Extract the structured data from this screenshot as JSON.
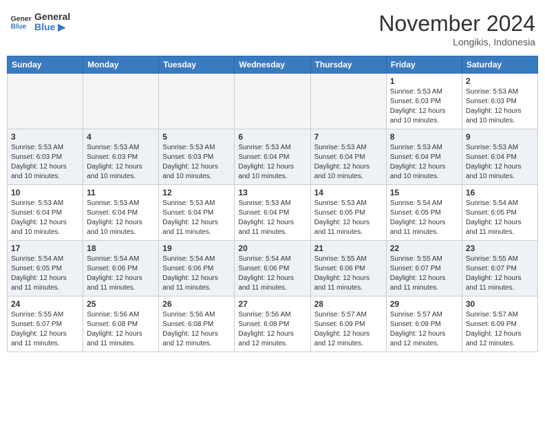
{
  "header": {
    "logo_line1": "General",
    "logo_line2": "Blue",
    "month_title": "November 2024",
    "location": "Longikis, Indonesia"
  },
  "weekdays": [
    "Sunday",
    "Monday",
    "Tuesday",
    "Wednesday",
    "Thursday",
    "Friday",
    "Saturday"
  ],
  "weeks": [
    [
      {
        "day": "",
        "empty": true
      },
      {
        "day": "",
        "empty": true
      },
      {
        "day": "",
        "empty": true
      },
      {
        "day": "",
        "empty": true
      },
      {
        "day": "",
        "empty": true
      },
      {
        "day": "1",
        "sunrise": "5:53 AM",
        "sunset": "6:03 PM",
        "daylight": "12 hours and 10 minutes."
      },
      {
        "day": "2",
        "sunrise": "5:53 AM",
        "sunset": "6:03 PM",
        "daylight": "12 hours and 10 minutes."
      }
    ],
    [
      {
        "day": "3",
        "sunrise": "5:53 AM",
        "sunset": "6:03 PM",
        "daylight": "12 hours and 10 minutes."
      },
      {
        "day": "4",
        "sunrise": "5:53 AM",
        "sunset": "6:03 PM",
        "daylight": "12 hours and 10 minutes."
      },
      {
        "day": "5",
        "sunrise": "5:53 AM",
        "sunset": "6:03 PM",
        "daylight": "12 hours and 10 minutes."
      },
      {
        "day": "6",
        "sunrise": "5:53 AM",
        "sunset": "6:04 PM",
        "daylight": "12 hours and 10 minutes."
      },
      {
        "day": "7",
        "sunrise": "5:53 AM",
        "sunset": "6:04 PM",
        "daylight": "12 hours and 10 minutes."
      },
      {
        "day": "8",
        "sunrise": "5:53 AM",
        "sunset": "6:04 PM",
        "daylight": "12 hours and 10 minutes."
      },
      {
        "day": "9",
        "sunrise": "5:53 AM",
        "sunset": "6:04 PM",
        "daylight": "12 hours and 10 minutes."
      }
    ],
    [
      {
        "day": "10",
        "sunrise": "5:53 AM",
        "sunset": "6:04 PM",
        "daylight": "12 hours and 10 minutes."
      },
      {
        "day": "11",
        "sunrise": "5:53 AM",
        "sunset": "6:04 PM",
        "daylight": "12 hours and 10 minutes."
      },
      {
        "day": "12",
        "sunrise": "5:53 AM",
        "sunset": "6:04 PM",
        "daylight": "12 hours and 11 minutes."
      },
      {
        "day": "13",
        "sunrise": "5:53 AM",
        "sunset": "6:04 PM",
        "daylight": "12 hours and 11 minutes."
      },
      {
        "day": "14",
        "sunrise": "5:53 AM",
        "sunset": "6:05 PM",
        "daylight": "12 hours and 11 minutes."
      },
      {
        "day": "15",
        "sunrise": "5:54 AM",
        "sunset": "6:05 PM",
        "daylight": "12 hours and 11 minutes."
      },
      {
        "day": "16",
        "sunrise": "5:54 AM",
        "sunset": "6:05 PM",
        "daylight": "12 hours and 11 minutes."
      }
    ],
    [
      {
        "day": "17",
        "sunrise": "5:54 AM",
        "sunset": "6:05 PM",
        "daylight": "12 hours and 11 minutes."
      },
      {
        "day": "18",
        "sunrise": "5:54 AM",
        "sunset": "6:06 PM",
        "daylight": "12 hours and 11 minutes."
      },
      {
        "day": "19",
        "sunrise": "5:54 AM",
        "sunset": "6:06 PM",
        "daylight": "12 hours and 11 minutes."
      },
      {
        "day": "20",
        "sunrise": "5:54 AM",
        "sunset": "6:06 PM",
        "daylight": "12 hours and 11 minutes."
      },
      {
        "day": "21",
        "sunrise": "5:55 AM",
        "sunset": "6:06 PM",
        "daylight": "12 hours and 11 minutes."
      },
      {
        "day": "22",
        "sunrise": "5:55 AM",
        "sunset": "6:07 PM",
        "daylight": "12 hours and 11 minutes."
      },
      {
        "day": "23",
        "sunrise": "5:55 AM",
        "sunset": "6:07 PM",
        "daylight": "12 hours and 11 minutes."
      }
    ],
    [
      {
        "day": "24",
        "sunrise": "5:55 AM",
        "sunset": "6:07 PM",
        "daylight": "12 hours and 11 minutes."
      },
      {
        "day": "25",
        "sunrise": "5:56 AM",
        "sunset": "6:08 PM",
        "daylight": "12 hours and 11 minutes."
      },
      {
        "day": "26",
        "sunrise": "5:56 AM",
        "sunset": "6:08 PM",
        "daylight": "12 hours and 12 minutes."
      },
      {
        "day": "27",
        "sunrise": "5:56 AM",
        "sunset": "6:08 PM",
        "daylight": "12 hours and 12 minutes."
      },
      {
        "day": "28",
        "sunrise": "5:57 AM",
        "sunset": "6:09 PM",
        "daylight": "12 hours and 12 minutes."
      },
      {
        "day": "29",
        "sunrise": "5:57 AM",
        "sunset": "6:09 PM",
        "daylight": "12 hours and 12 minutes."
      },
      {
        "day": "30",
        "sunrise": "5:57 AM",
        "sunset": "6:09 PM",
        "daylight": "12 hours and 12 minutes."
      }
    ]
  ],
  "labels": {
    "sunrise_prefix": "Sunrise: ",
    "sunset_prefix": "Sunset: ",
    "daylight_prefix": "Daylight: "
  }
}
